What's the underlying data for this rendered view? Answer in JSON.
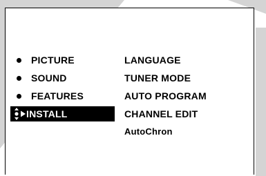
{
  "main_menu": {
    "items": [
      {
        "label": "PICTURE",
        "marker": "bullet-icon"
      },
      {
        "label": "SOUND",
        "marker": "bullet-icon"
      },
      {
        "label": "FEATURES",
        "marker": "bullet-icon"
      },
      {
        "label": "INSTALL",
        "marker": "updown-arrow-pointer-icon",
        "selected": true
      }
    ]
  },
  "sub_menu": {
    "items": [
      {
        "label": "LANGUAGE"
      },
      {
        "label": "TUNER MODE"
      },
      {
        "label": "AUTO PROGRAM"
      },
      {
        "label": "CHANNEL EDIT"
      },
      {
        "label": "AutoChron"
      }
    ]
  },
  "colors": {
    "panel_background": "#ffffff",
    "text": "#000000",
    "selection_background": "#000000",
    "selection_text": "#ffffff",
    "surround": "#d4d4d4"
  }
}
